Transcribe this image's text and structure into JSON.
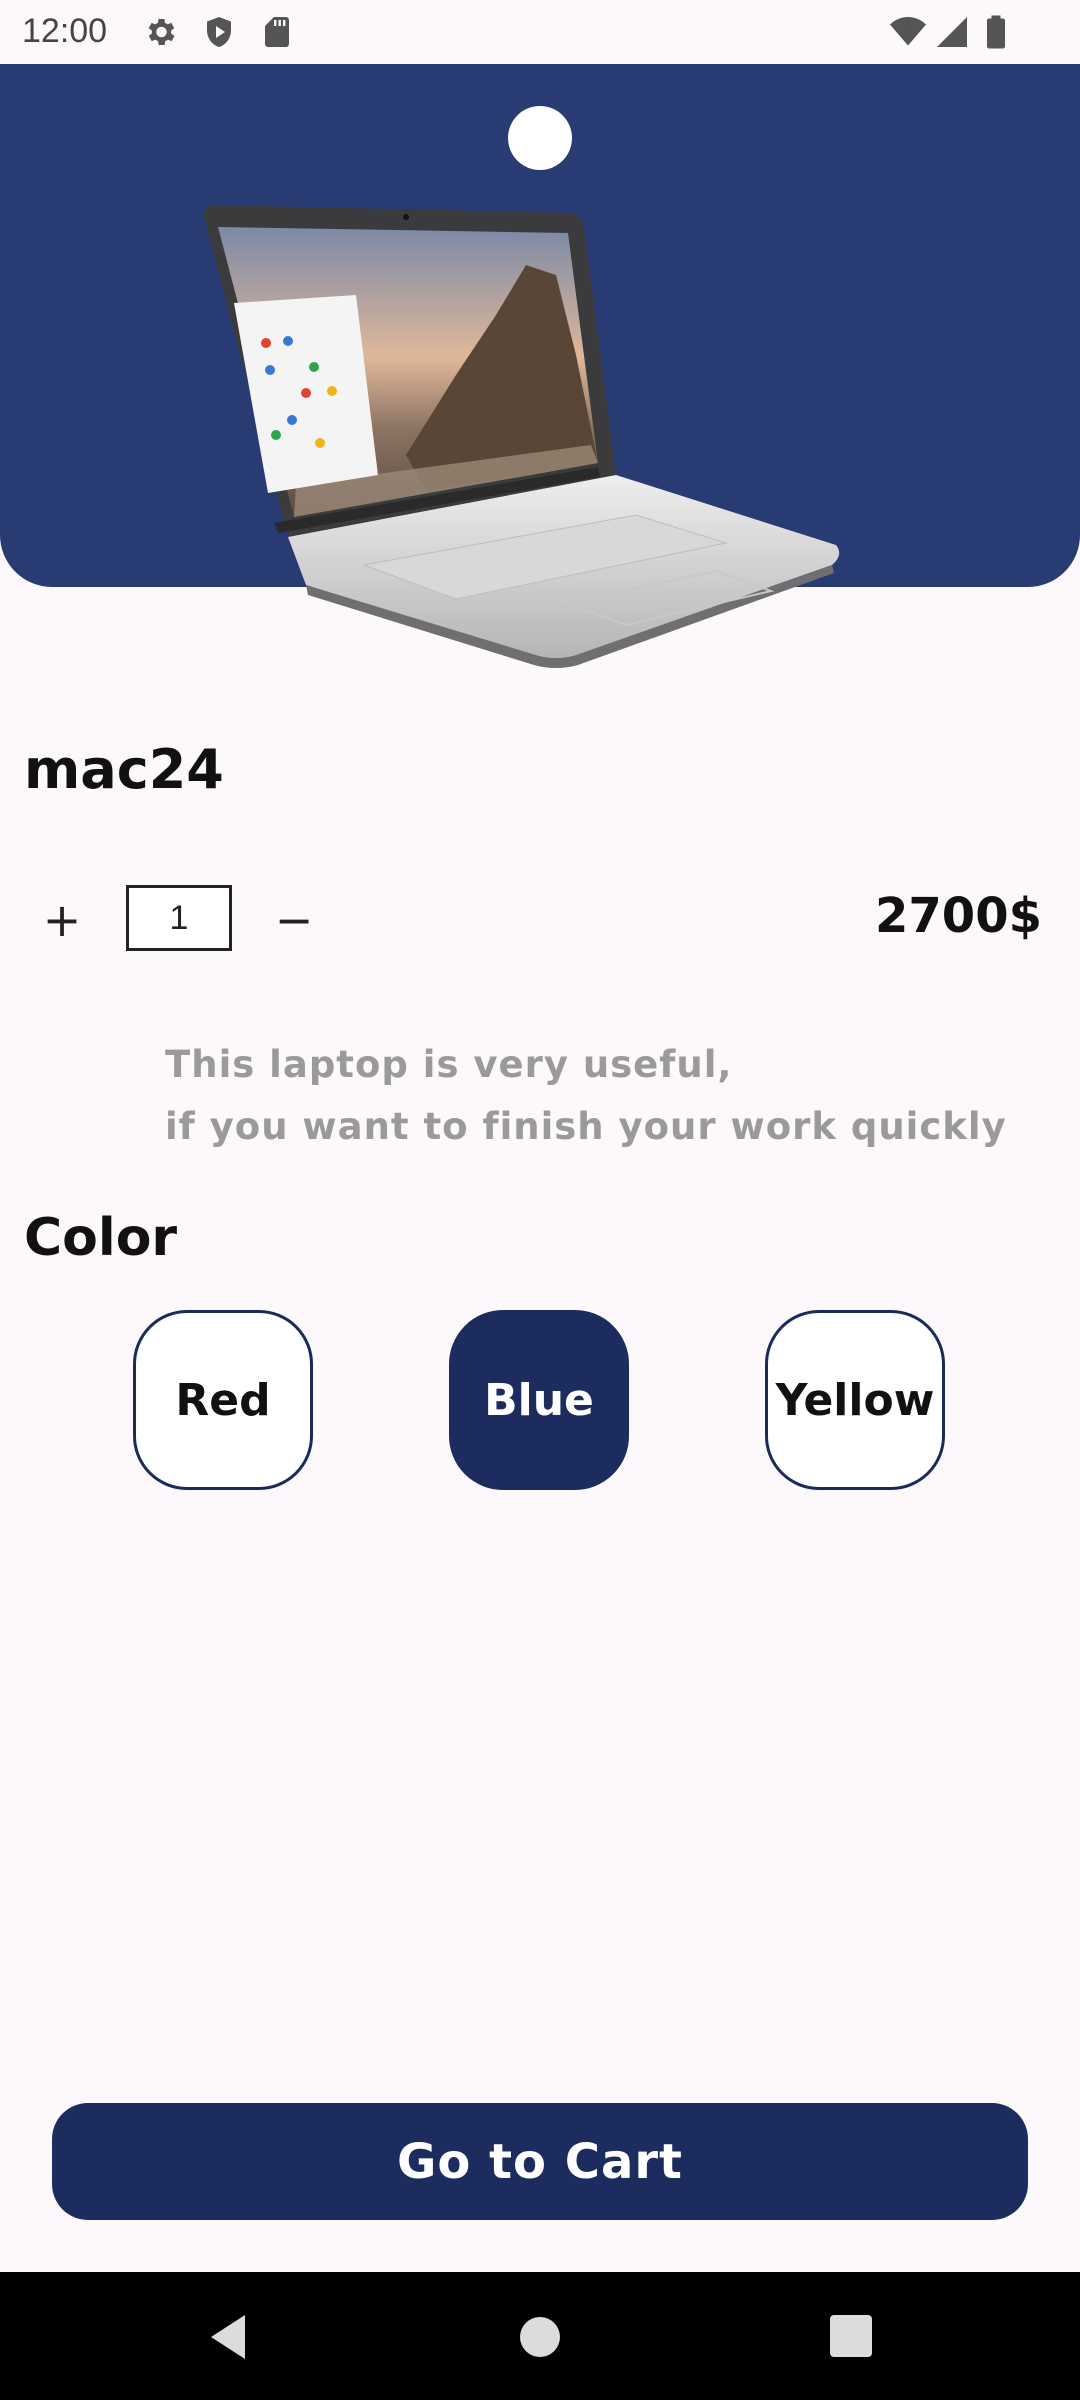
{
  "status_bar": {
    "time": "12:00",
    "left_icons": [
      "gear-icon",
      "shield-icon",
      "sd-card-icon"
    ],
    "right_icons": [
      "wifi-icon",
      "cellular-signal-icon",
      "battery-icon"
    ]
  },
  "hero": {
    "background_color": "#283c73",
    "image": "laptop-image"
  },
  "product": {
    "name": "mac24",
    "quantity": "1",
    "plus_label": "+",
    "minus_label": "−",
    "price": "2700$",
    "description_lines": [
      "This laptop is very useful,",
      "if you want to finish your work quickly"
    ]
  },
  "color_section": {
    "title": "Color",
    "options": [
      {
        "label": "Red",
        "selected": false
      },
      {
        "label": "Blue",
        "selected": true
      },
      {
        "label": "Yellow",
        "selected": false
      }
    ]
  },
  "cart_button": {
    "label": "Go to Cart",
    "color": "#1c2c5e"
  },
  "nav_bar": {
    "icons": [
      "back-icon",
      "home-icon",
      "recents-icon"
    ]
  }
}
